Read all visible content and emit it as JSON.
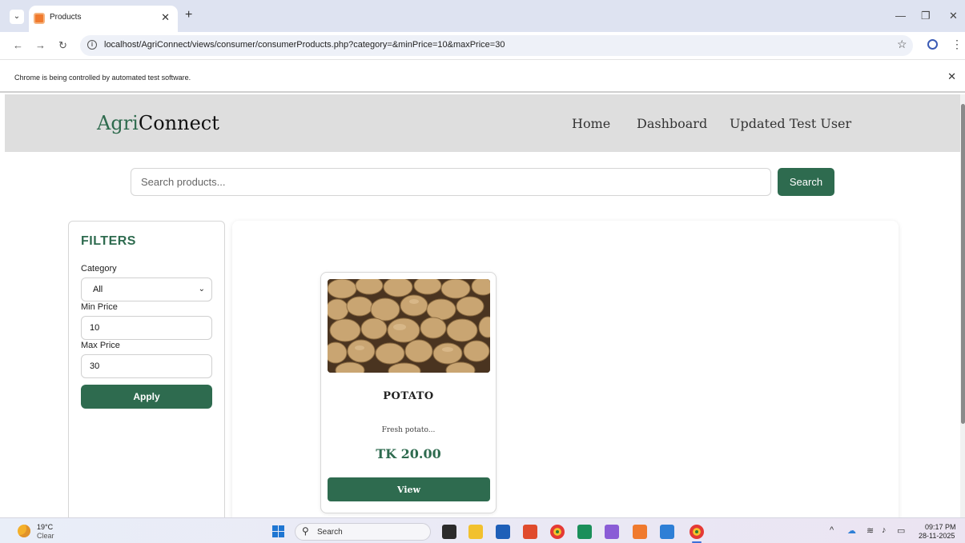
{
  "browser": {
    "tab_title": "Products",
    "url": "localhost/AgriConnect/views/consumer/consumerProducts.php?category=&minPrice=10&maxPrice=30",
    "automation_notice": "Chrome is being controlled by automated test software."
  },
  "site": {
    "brand_prefix": "Agri",
    "brand_suffix": "Connect",
    "nav": [
      "Home",
      "Dashboard",
      "Updated Test User"
    ]
  },
  "search": {
    "placeholder": "Search products...",
    "button_label": "Search"
  },
  "filters": {
    "title": "FILTERS",
    "category_label": "Category",
    "category_value": "All",
    "min_label": "Min Price",
    "min_value": "10",
    "max_label": "Max Price",
    "max_value": "30",
    "apply_label": "Apply"
  },
  "products": [
    {
      "name": "POTATO",
      "description": "Fresh potato...",
      "price": "TK 20.00",
      "view_label": "View"
    }
  ],
  "taskbar": {
    "temperature": "19°C",
    "condition": "Clear",
    "search_text": "Search",
    "time": "09:17 PM",
    "date": "28-11-2025"
  },
  "colors": {
    "accent": "#2e6b4f",
    "header_bg": "#dedede"
  }
}
